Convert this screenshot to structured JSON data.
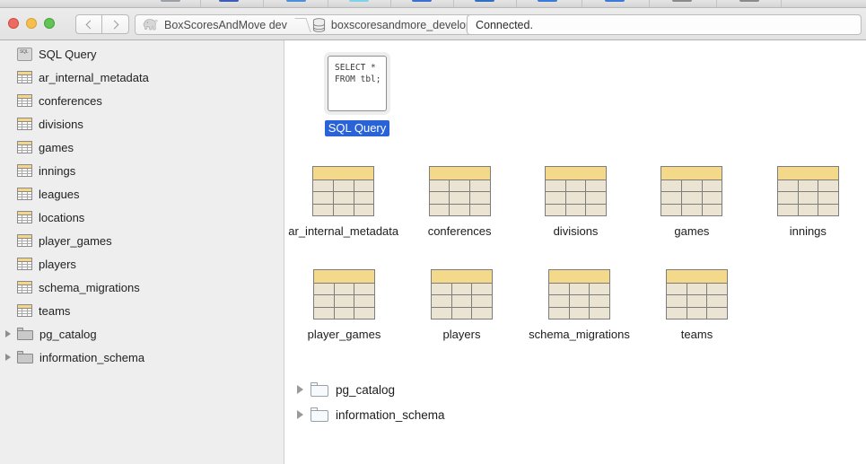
{
  "window": {
    "traffic_lights": [
      "close",
      "minimize",
      "zoom"
    ],
    "colors": {
      "close": "#ec6a5f",
      "minimize": "#f5bf4f",
      "zoom": "#61c454",
      "sidebar_bg": "#eeeeee",
      "content_bg": "#ffffff",
      "selection_blue": "#2a63d8",
      "table_header_gold": "#f5d98a",
      "table_cell_beige": "#ece4d3",
      "table_border_gray": "#7d7d7d"
    }
  },
  "top_toolbar": {
    "note": "toolbar row is clipped at the top edge of the screenshot; labels are not legible",
    "items": [
      {
        "label": "",
        "icon": "toolbar-icon",
        "color": "#9aa0a6"
      },
      {
        "label": "",
        "icon": "toolbar-icon",
        "color": "#3b5cb8"
      },
      {
        "label": "",
        "icon": "toolbar-icon",
        "color": "#4a90d9"
      },
      {
        "label": "",
        "icon": "toolbar-icon",
        "color": "#7fd3e8"
      },
      {
        "label": "",
        "icon": "toolbar-icon",
        "color": "#3c6fd0"
      },
      {
        "label": "",
        "icon": "toolbar-icon",
        "color": "#2f6fc4"
      },
      {
        "label": "",
        "icon": "toolbar-icon",
        "color": "#3c7ad8"
      },
      {
        "label": "",
        "icon": "toolbar-icon",
        "color": "#3c7ad8"
      },
      {
        "label": "",
        "icon": "toolbar-icon",
        "color": "#8a8a8a"
      },
      {
        "label": "",
        "icon": "toolbar-icon",
        "color": "#8a8a8a"
      }
    ]
  },
  "toolbar": {
    "back_label": "Back",
    "forward_label": "Forward",
    "breadcrumb": [
      {
        "label": "BoxScoresAndMove dev",
        "icon": "elephant-icon"
      },
      {
        "label": "boxscoresandmore_development",
        "icon": "database-icon"
      }
    ],
    "status": "Connected."
  },
  "sidebar": {
    "items": [
      {
        "label": "SQL Query",
        "icon": "sql-query-icon",
        "type": "query"
      },
      {
        "label": "ar_internal_metadata",
        "icon": "table-icon",
        "type": "table"
      },
      {
        "label": "conferences",
        "icon": "table-icon",
        "type": "table"
      },
      {
        "label": "divisions",
        "icon": "table-icon",
        "type": "table"
      },
      {
        "label": "games",
        "icon": "table-icon",
        "type": "table"
      },
      {
        "label": "innings",
        "icon": "table-icon",
        "type": "table"
      },
      {
        "label": "leagues",
        "icon": "table-icon",
        "type": "table"
      },
      {
        "label": "locations",
        "icon": "table-icon",
        "type": "table"
      },
      {
        "label": "player_games",
        "icon": "table-icon",
        "type": "table"
      },
      {
        "label": "players",
        "icon": "table-icon",
        "type": "table"
      },
      {
        "label": "schema_migrations",
        "icon": "table-icon",
        "type": "table"
      },
      {
        "label": "teams",
        "icon": "table-icon",
        "type": "table"
      },
      {
        "label": "pg_catalog",
        "icon": "folder-icon",
        "type": "schema",
        "expanded": false
      },
      {
        "label": "information_schema",
        "icon": "folder-icon",
        "type": "schema",
        "expanded": false
      }
    ]
  },
  "content": {
    "query_item": {
      "preview_text": "SELECT *\nFROM tbl;",
      "label": "SQL Query",
      "selected": true
    },
    "tables_row1": [
      {
        "label": "ar_internal_metadata",
        "icon": "table-icon"
      },
      {
        "label": "conferences",
        "icon": "table-icon"
      },
      {
        "label": "divisions",
        "icon": "table-icon"
      },
      {
        "label": "games",
        "icon": "table-icon"
      },
      {
        "label": "innings",
        "icon": "table-icon"
      }
    ],
    "tables_row2": [
      {
        "label": "player_games",
        "icon": "table-icon"
      },
      {
        "label": "players",
        "icon": "table-icon"
      },
      {
        "label": "schema_migrations",
        "icon": "table-icon"
      },
      {
        "label": "teams",
        "icon": "table-icon"
      }
    ],
    "schemas": [
      {
        "label": "pg_catalog",
        "icon": "folder-icon",
        "expanded": false
      },
      {
        "label": "information_schema",
        "icon": "folder-icon",
        "expanded": false
      }
    ]
  }
}
